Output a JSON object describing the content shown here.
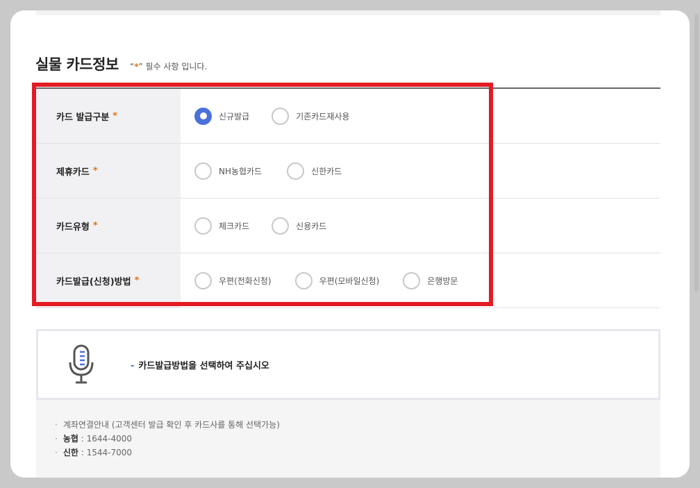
{
  "section": {
    "title": "실물 카드정보",
    "required_note_open": "“",
    "required_note_star": "*",
    "required_note_close": "” 필수 사항 입니다."
  },
  "form": {
    "required_mark": "*",
    "rows": [
      {
        "label": "카드 발급구분",
        "options": [
          {
            "label": "신규발급",
            "checked": true
          },
          {
            "label": "기존카드재사용",
            "checked": false
          }
        ]
      },
      {
        "label": "제휴카드",
        "options": [
          {
            "label": "NH농협카드",
            "checked": false
          },
          {
            "label": "신한카드",
            "checked": false
          }
        ]
      },
      {
        "label": "카드유형",
        "options": [
          {
            "label": "체크카드",
            "checked": false
          },
          {
            "label": "신용카드",
            "checked": false
          }
        ]
      },
      {
        "label": "카드발급(신청)방법",
        "options": [
          {
            "label": "우편(전화신청)",
            "checked": false
          },
          {
            "label": "우편(모바일신청)",
            "checked": false
          },
          {
            "label": "은행방문",
            "checked": false
          }
        ]
      }
    ]
  },
  "notice": {
    "icon": "microphone-icon",
    "dash": "-",
    "message": "카드발급방법을 선택하여 주십시오"
  },
  "info": {
    "bullet": "·",
    "items": [
      {
        "bold": "",
        "text": "계좌연결안내 (고객센터 발급 확인 후 카드사를 통해 선택가능)"
      },
      {
        "bold": "농협",
        "text": " : 1644-4000"
      },
      {
        "bold": "신한",
        "text": " : 1544-7000"
      }
    ]
  },
  "colors": {
    "accent": "#4a72d9",
    "required_star": "#e0731c",
    "highlight": "#e31b23"
  }
}
